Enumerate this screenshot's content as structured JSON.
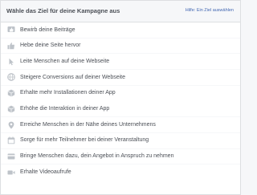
{
  "header": {
    "title": "Wähle das Ziel für deine Kampagne aus",
    "help_link": "Hilfe: Ein Ziel auswählen"
  },
  "objectives": [
    {
      "icon": "thumbs-up-post-icon",
      "label": "Bewirb deine Beiträge"
    },
    {
      "icon": "thumbs-up-icon",
      "label": "Hebe deine Seite hervor"
    },
    {
      "icon": "cursor-icon",
      "label": "Leite Menschen auf deine Webseite"
    },
    {
      "icon": "globe-icon",
      "label": "Steigere Conversions auf deiner Webseite"
    },
    {
      "icon": "app-box-icon",
      "label": "Erhalte mehr Installationen deiner App"
    },
    {
      "icon": "app-box-icon",
      "label": "Erhöhe die Interaktion in deiner App"
    },
    {
      "icon": "location-pin-icon",
      "label": "Erreiche Menschen in der Nähe deines Unternehmens"
    },
    {
      "icon": "calendar-icon",
      "label": "Sorge für mehr Teilnehmer bei deiner Veranstaltung"
    },
    {
      "icon": "offer-icon",
      "label": "Bringe Menschen dazu, dein Angebot in Anspruch zu nehmen"
    },
    {
      "icon": "video-camera-icon",
      "label": "Erhalte Videoaufrufe"
    }
  ]
}
